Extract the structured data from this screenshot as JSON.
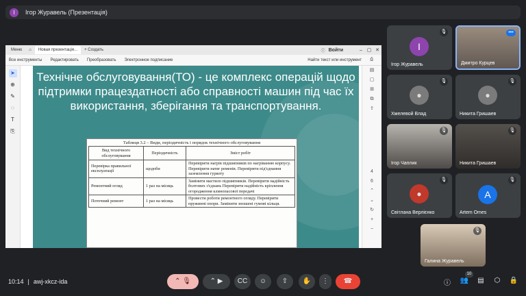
{
  "topbar": {
    "avatar_letter": "І",
    "title": "Ігор Журавель (Презентація)"
  },
  "browser": {
    "tab_menu": "Меню",
    "tab_active": "Новая презентація...",
    "tab_new": "+ Создать",
    "login": "Войти",
    "toolbar_items": [
      "Все инструменты",
      "Редактировать",
      "Преобразовать",
      "Электронное подписание"
    ],
    "search_placeholder": "Найти текст или инструмент",
    "page_number": "4",
    "page_total": "6"
  },
  "slide": {
    "title": "Технічне обслуговування(ТО) - це комплекс операцій щодо підтримки працездатності або справності машин під час їх використання, зберігання та транспортування.",
    "table_caption": "Таблиця 3.2 – Види, періодичність і порядок технічного обслуговування",
    "headers": [
      "Вид технічного обслуговування",
      "Періодичність",
      "Зміст робіт"
    ],
    "rows": [
      [
        "Перевірка правильної експлуатації",
        "щодоби",
        "Перевірити нагрів підшипників по нагріванню корпусу. Перевірити натяг ременів. Перевірити під'єднання заземлення гуркоту"
      ],
      [
        "Ремонтний огляд",
        "1 раз на місяць",
        "Замінити мастило підшипників. Перевірити надійність болтових з'єднань Перевірити надійність кріплення огородження клинопасової передачі"
      ],
      [
        "Поточний ремонт",
        "1 раз на місяць",
        "Провести роботи ремонтного огляду. Перевірити пружинні опори. Замінити зношені гумові кільця."
      ]
    ]
  },
  "participants": [
    {
      "name": "Ігор Журавель",
      "avatar": "І",
      "color": "#8e44ad"
    },
    {
      "name": "Дмитро Курцев",
      "more": "•••"
    },
    {
      "name": "Хмелевой Влад"
    },
    {
      "name": "Никита Гришаев"
    },
    {
      "name": "Ігор Чаплик"
    },
    {
      "name": "Никита Гришаев"
    },
    {
      "name": "Світлана Верлієнко"
    },
    {
      "name": "Artem Omes",
      "avatar": "A",
      "color": "#1a73e8"
    },
    {
      "name": "Галина Журавель"
    }
  ],
  "bottom": {
    "time": "10:14",
    "meeting_code": "awj-xkcz-ida",
    "people_count": "10"
  }
}
